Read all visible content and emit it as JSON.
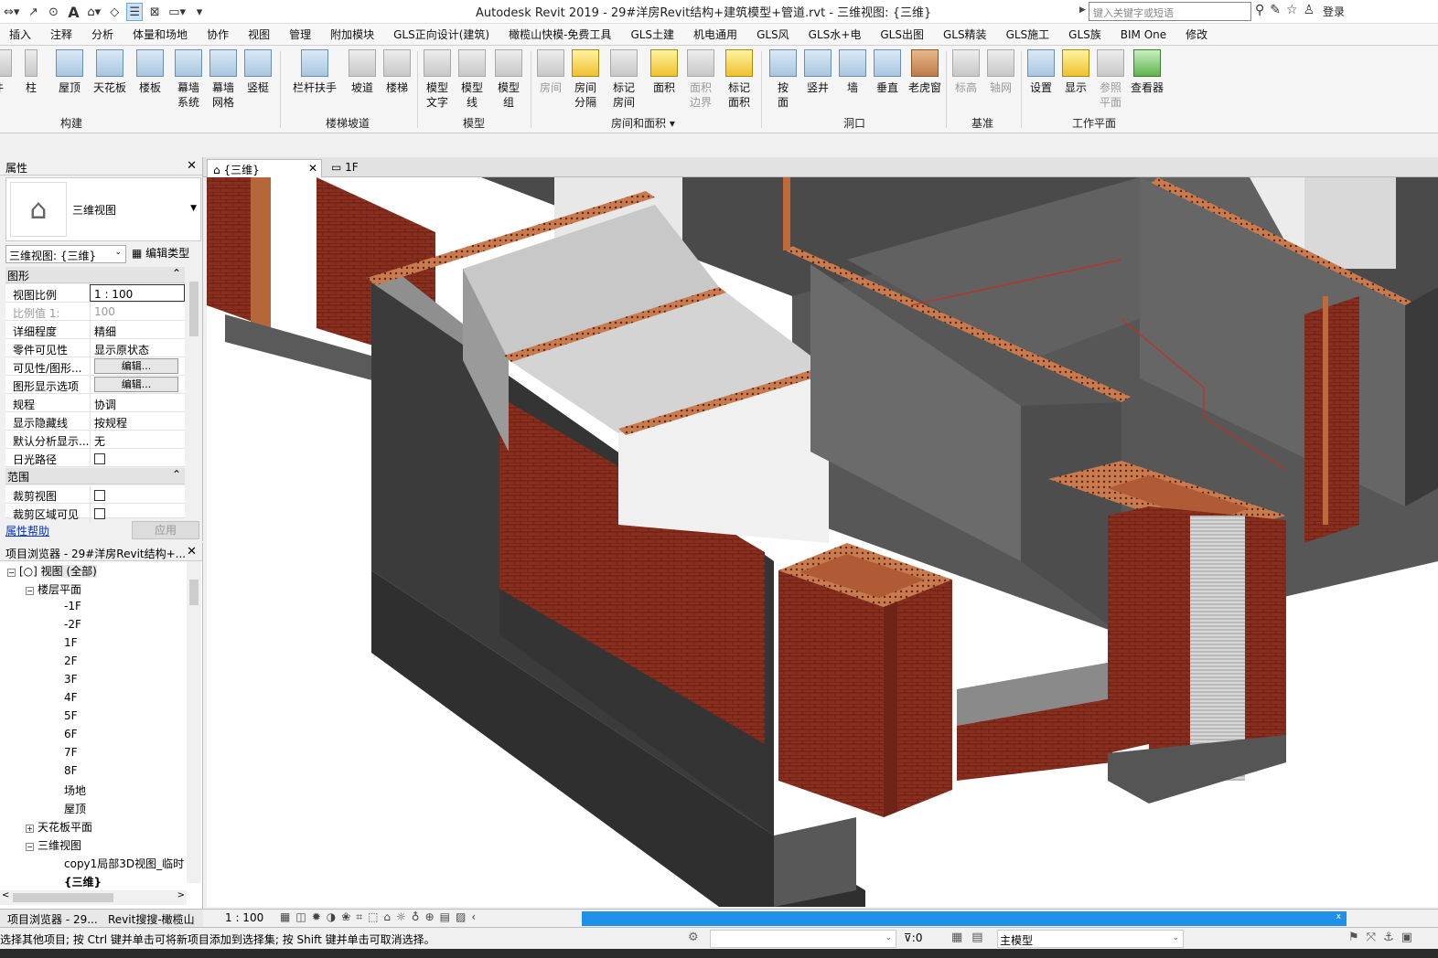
{
  "titlebar": {
    "app_title": "Autodesk Revit 2019 - 29#洋房Revit结构+建筑模型+管道.rvt - 三维视图: {三维}",
    "search_placeholder": "键入关键字或短语",
    "login": "登录"
  },
  "menu": {
    "tabs": [
      "插入",
      "注释",
      "分析",
      "体量和场地",
      "协作",
      "视图",
      "管理",
      "附加模块",
      "GLS正向设计(建筑)",
      "橄榄山快模-免费工具",
      "GLS土建",
      "机电通用",
      "GLS风",
      "GLS水+电",
      "GLS出图",
      "GLS精装",
      "GLS施工",
      "GLS族",
      "BIM One",
      "修改"
    ]
  },
  "ribbon": {
    "buttons": {
      "b0": "件",
      "b1": "柱",
      "b2": "屋顶",
      "b3": "天花板",
      "b4": "楼板",
      "b5a": "幕墙",
      "b5b": "系统",
      "b6a": "幕墙",
      "b6b": "网格",
      "b7": "竖梃",
      "b8": "栏杆扶手",
      "b9": "坡道",
      "b10": "楼梯",
      "b11a": "模型",
      "b11b": "文字",
      "b12a": "模型",
      "b12b": "线",
      "b13a": "模型",
      "b13b": "组",
      "b14": "房间",
      "b15a": "房间",
      "b15b": "分隔",
      "b16a": "标记",
      "b16b": "房间",
      "b17": "面积",
      "b18a": "面积",
      "b18b": "边界",
      "b19a": "标记",
      "b19b": "面积",
      "b20a": "按",
      "b20b": "面",
      "b21": "竖井",
      "b22": "墙",
      "b23": "垂直",
      "b24": "老虎窗",
      "b25": "标高",
      "b26": "轴网",
      "b27": "设置",
      "b28": "显示",
      "b29a": "参照",
      "b29b": "平面",
      "b30": "查看器"
    },
    "groups": {
      "build": "构建",
      "circulation": "楼梯坡道",
      "model": "模型",
      "room": "房间和面积",
      "opening": "洞口",
      "datum": "基准",
      "workplane": "工作平面"
    }
  },
  "properties": {
    "title": "属性",
    "type_name": "三维视图",
    "view_selector": "三维视图: {三维}",
    "edit_type": "编辑类型",
    "section_graphics": "图形",
    "rows": [
      {
        "label": "视图比例",
        "value": "1 : 100"
      },
      {
        "label": "比例值 1:",
        "value": "100"
      },
      {
        "label": "详细程度",
        "value": "精细"
      },
      {
        "label": "零件可见性",
        "value": "显示原状态"
      },
      {
        "label": "可见性/图形...",
        "value": "编辑..."
      },
      {
        "label": "图形显示选项",
        "value": "编辑..."
      },
      {
        "label": "规程",
        "value": "协调"
      },
      {
        "label": "显示隐藏线",
        "value": "按规程"
      },
      {
        "label": "默认分析显示...",
        "value": "无"
      },
      {
        "label": "日光路径",
        "value": ""
      }
    ],
    "section_extents": "范围",
    "rows2": [
      {
        "label": "裁剪视图",
        "value": ""
      },
      {
        "label": "裁剪区域可见",
        "value": ""
      }
    ],
    "help": "属性帮助",
    "apply": "应用"
  },
  "browser": {
    "title": "项目浏览器 - 29#洋房Revit结构+...",
    "views_all": "视图 (全部)",
    "floor_plans": "楼层平面",
    "levels": [
      "-1F",
      "-2F",
      "1F",
      "2F",
      "3F",
      "4F",
      "5F",
      "6F",
      "7F",
      "8F",
      "场地",
      "屋顶"
    ],
    "ceiling_plans": "天花板平面",
    "views_3d": "三维视图",
    "view_3d_items": [
      "copy1局部3D视图_临时",
      "{三维}"
    ],
    "bottom_tabs": [
      "项目浏览器 - 29...",
      "Revit搜搜-橄榄山"
    ]
  },
  "viewtabs": {
    "tab1": "{三维}",
    "tab2": "1F"
  },
  "viewbar": {
    "scale": "1 : 100"
  },
  "status": {
    "text": "选择其他项目; 按 Ctrl 键并单击可将新项目添加到选择集; 按 Shift 键并单击可取消选择。",
    "filter_count": ":0",
    "model": "主模型"
  },
  "colors": {
    "brick": "#8a2e1e",
    "concrete_dark": "#3e3e3e",
    "wall_gray": "#6b6b6b",
    "accent_blue": "#1e90e8"
  }
}
